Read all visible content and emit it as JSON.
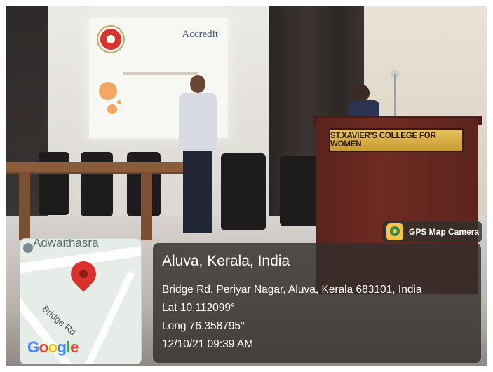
{
  "photo": {
    "slide_logo_text": "Accredit",
    "podium_text": "ST.XAVIER'S COLLEGE FOR WOMEN"
  },
  "map": {
    "top_label": "Adwaithasra",
    "road_label": "Bridge Rd",
    "attribution": "Google"
  },
  "location": {
    "place": "Aluva, Kerala, India",
    "address": "Bridge Rd, Periyar Nagar, Aluva, Kerala 683101, India",
    "lat": "Lat 10.112099°",
    "long": "Long 76.358795°",
    "datetime": "12/10/21 09:39 AM"
  },
  "badge": {
    "label": "GPS Map Camera",
    "icon": "gps-map-camera-icon"
  }
}
